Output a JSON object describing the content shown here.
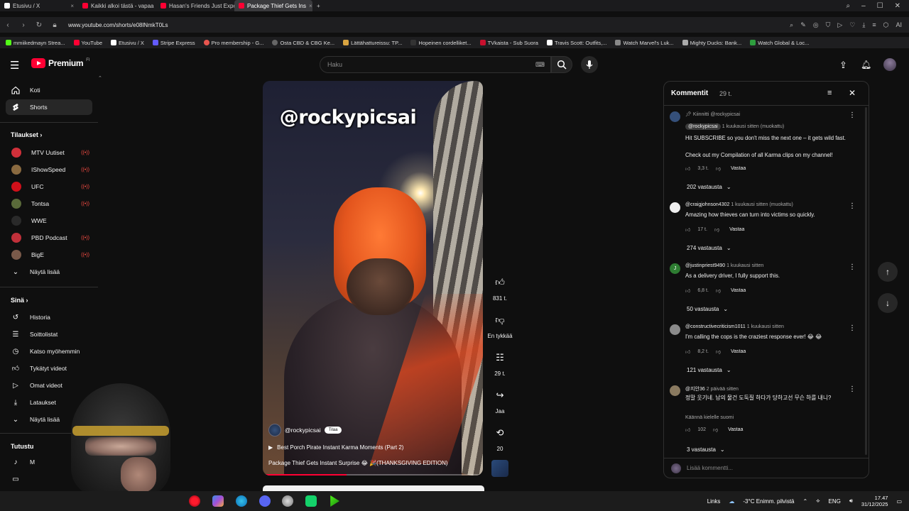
{
  "browser": {
    "tabs": [
      {
        "label": "Etusivu / X",
        "color": "#ffffff"
      },
      {
        "label": "Kaikki alkoi tästä - vapaa",
        "color": "#ff0033"
      },
      {
        "label": "Hasan's Friends Just Expo",
        "color": "#ff0033"
      },
      {
        "label": "Package Thief Gets Ins",
        "color": "#ff0033"
      }
    ],
    "url": "www.youtube.com/shorts/e08lNmkT0Ls",
    "bookmarks": [
      "mmiikedmayn Strea...",
      "YouTube",
      "Etusivu / X",
      "Stripe Express",
      "Pro membership - G...",
      "Osta CBD & CBG Ke...",
      "Lättähattureissu: TP...",
      "Hopeinen cordelliket...",
      "TVkaista - Sub Suora",
      "Travis Scott: Outfits,...",
      "Watch Marvel's Luk...",
      "Mighty Ducks: Bank...",
      "Watch Global & Loc..."
    ]
  },
  "header": {
    "logo": "Premium",
    "logo_sup": "FI",
    "search_placeholder": "Haku"
  },
  "sidebar": {
    "top": [
      {
        "label": "Koti",
        "icon": "home-icon"
      },
      {
        "label": "Shorts",
        "icon": "shorts-icon"
      }
    ],
    "subs_heading": "Tilaukset",
    "subs": [
      {
        "label": "MTV Uutiset",
        "color": "#d0303a"
      },
      {
        "label": "IShowSpeed",
        "color": "#8a6a40"
      },
      {
        "label": "UFC",
        "color": "#d0101a"
      },
      {
        "label": "Tontsa",
        "color": "#5a6a3a"
      },
      {
        "label": "WWE",
        "color": "#2a2a2a"
      },
      {
        "label": "PBD Podcast",
        "color": "#c0303a"
      },
      {
        "label": "BigE",
        "color": "#7a5a4a"
      }
    ],
    "show_more": "Näytä lisää",
    "you_heading": "Sinä",
    "you": [
      {
        "label": "Historia",
        "icon": "history-icon"
      },
      {
        "label": "Soittolistat",
        "icon": "playlist-icon"
      },
      {
        "label": "Katso myöhemmin",
        "icon": "clock-icon"
      },
      {
        "label": "Tykätyt videot",
        "icon": "like-icon"
      },
      {
        "label": "Omat videot",
        "icon": "video-icon"
      },
      {
        "label": "Lataukset",
        "icon": "download-icon"
      },
      {
        "label": "Näytä lisää",
        "icon": "chevron-down-icon"
      }
    ],
    "explore_heading": "Tutustu"
  },
  "video": {
    "overlay_handle": "@rockypicsai",
    "channel": "@rockypicsai",
    "subscribe": "Tilaa",
    "playlist": "Best Porch Pirate Instant Karma Moments (Part 2)",
    "title": "Package Thief Gets Instant Surprise 😂 🎉(THANKSGIVING EDITION)",
    "progress_percent": 38
  },
  "actions": {
    "likes": "831 t.",
    "dislike": "En tykkää",
    "comments": "29 t.",
    "share": "Jaa",
    "remix": "20"
  },
  "comments": {
    "title": "Kommentit",
    "count": "29 t.",
    "input_placeholder": "Lisää kommentti...",
    "items": [
      {
        "pinned": "Kiinnitti @rockypicsai",
        "author": "@rockypicsai",
        "time": "1 kuukausi sitten (muokattu)",
        "text": "Hit SUBSCRIBE so you don't miss the next one – it gets wild fast.",
        "text2": "Check out my Compilation of all Karma clips on my channel!",
        "likes": "3,3 t.",
        "replies": "202 vastausta",
        "color": "#35507a"
      },
      {
        "author": "@craigjohnson4302",
        "time": "1 kuukausi sitten (muokattu)",
        "text": "Amazing how thieves can turn into victims so quickly.",
        "likes": "17 t.",
        "replies": "274 vastausta",
        "color": "#eeeeee"
      },
      {
        "author": "@justinpriest9490",
        "time": "1 kuukausi sitten",
        "text": "As a delivery driver, I fully support this.",
        "likes": "6,8 t.",
        "replies": "50 vastausta",
        "color": "#2e7d32",
        "initial": "J"
      },
      {
        "author": "@constructivecriticism1011",
        "time": "1 kuukausi sitten",
        "text": "I'm calling the cops is the craziest response ever! 😂 😂",
        "likes": "8,2 t.",
        "replies": "121 vastausta",
        "color": "#8a8a8a"
      },
      {
        "author": "@지안36",
        "time": "2 päivää sitten",
        "text": "정말 웃기네. 남의 물건 도둑질 하다가 당하고선 무슨 하를 내니?",
        "translate": "Käännä kielelle suomi",
        "likes": "102",
        "replies": "3 vastausta",
        "color": "#8a7a60"
      }
    ],
    "like_label": "",
    "reply_label": "Vastaa"
  },
  "taskbar": {
    "links": "Links",
    "weather": "-3°C  Enimm. pilvistä",
    "lang": "ENG",
    "time": "17.47",
    "date": "31/12/2025"
  }
}
